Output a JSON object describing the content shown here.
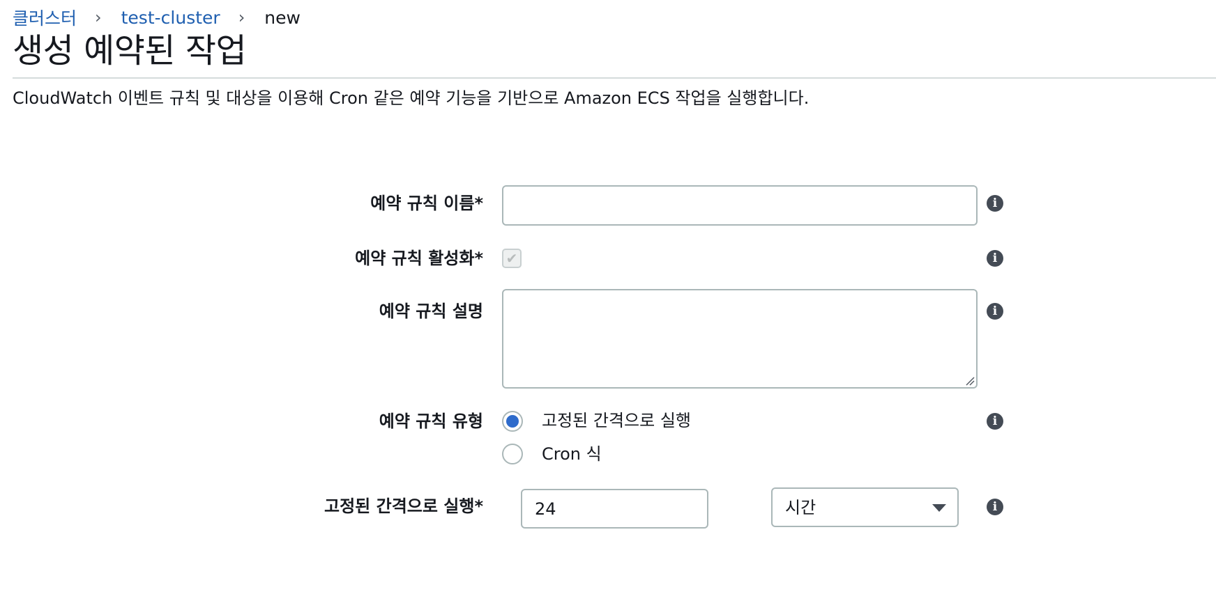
{
  "breadcrumb": {
    "items": [
      "클러스터",
      "test-cluster"
    ],
    "separator": "›",
    "current": "new"
  },
  "page": {
    "title": "생성 예약된 작업",
    "description": "CloudWatch 이벤트 규칙 및 대상을 이용해 Cron 같은 예약 기능을 기반으로 Amazon ECS 작업을 실행합니다."
  },
  "form": {
    "rule_name": {
      "label": "예약 규칙 이름*",
      "value": "",
      "placeholder": ""
    },
    "rule_enabled": {
      "label": "예약 규칙 활성화*",
      "checked": true,
      "disabled": true,
      "check_glyph": "✔"
    },
    "rule_description": {
      "label": "예약 규칙 설명",
      "value": ""
    },
    "rule_type": {
      "label": "예약 규칙 유형",
      "options": [
        "고정된 간격으로 실행",
        "Cron 식"
      ],
      "selected": "고정된 간격으로 실행"
    },
    "fixed_interval": {
      "label": "고정된 간격으로 실행*",
      "value": "24",
      "unit": "시간"
    }
  },
  "icons": {
    "info": "i"
  },
  "colors": {
    "link": "#1f5fb0",
    "radio_selected": "#2e6bcb",
    "input_border": "#aab7b8",
    "info_icon": "#444b55"
  }
}
